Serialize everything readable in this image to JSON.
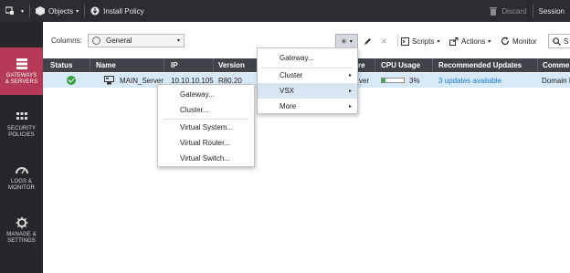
{
  "topbar": {
    "objects_label": "Objects",
    "install_policy_label": "Install Policy",
    "discard_label": "Discard",
    "session_label": "Session"
  },
  "sidebar": {
    "items": [
      {
        "line1": "GATEWAYS",
        "line2": "& SERVERS"
      },
      {
        "line1": "SECURITY",
        "line2": "POLICIES"
      },
      {
        "line1": "LOGS &",
        "line2": "MONITOR"
      },
      {
        "line1": "MANAGE &",
        "line2": "SETTINGS"
      }
    ]
  },
  "toolbar": {
    "columns_label": "Columns:",
    "columns_value": "General",
    "new_symbol": "✳",
    "scripts_label": "Scripts",
    "actions_label": "Actions",
    "monitor_label": "Monitor",
    "search_text": "S"
  },
  "table": {
    "headers": [
      "Status",
      "Name",
      "IP",
      "Version",
      "re",
      "CPU Usage",
      "Recommended Updates",
      "Comme"
    ],
    "row": {
      "name": "MAIN_Server",
      "ip": "10.10.10.105",
      "version": "R80.20",
      "hardware": "ver",
      "cpu": "3%",
      "cpu_fraction": 0.03,
      "updates": "3 updates available",
      "comments": "Domain I"
    }
  },
  "new_menu": {
    "items": [
      "Gateway...",
      "Cluster",
      "VSX",
      "More"
    ]
  },
  "vsx_menu": {
    "items": [
      "Gateway...",
      "Cluster...",
      "Virtual System...",
      "Virtual Router...",
      "Virtual Switch..."
    ]
  },
  "colors": {
    "accent": "#b43a57",
    "topbar": "#2b2c30",
    "sidebar": "#26272b",
    "header": "#3f444b",
    "selected_row": "#d7e8f7",
    "link": "#1e7fd0",
    "ok": "#3aa142"
  }
}
